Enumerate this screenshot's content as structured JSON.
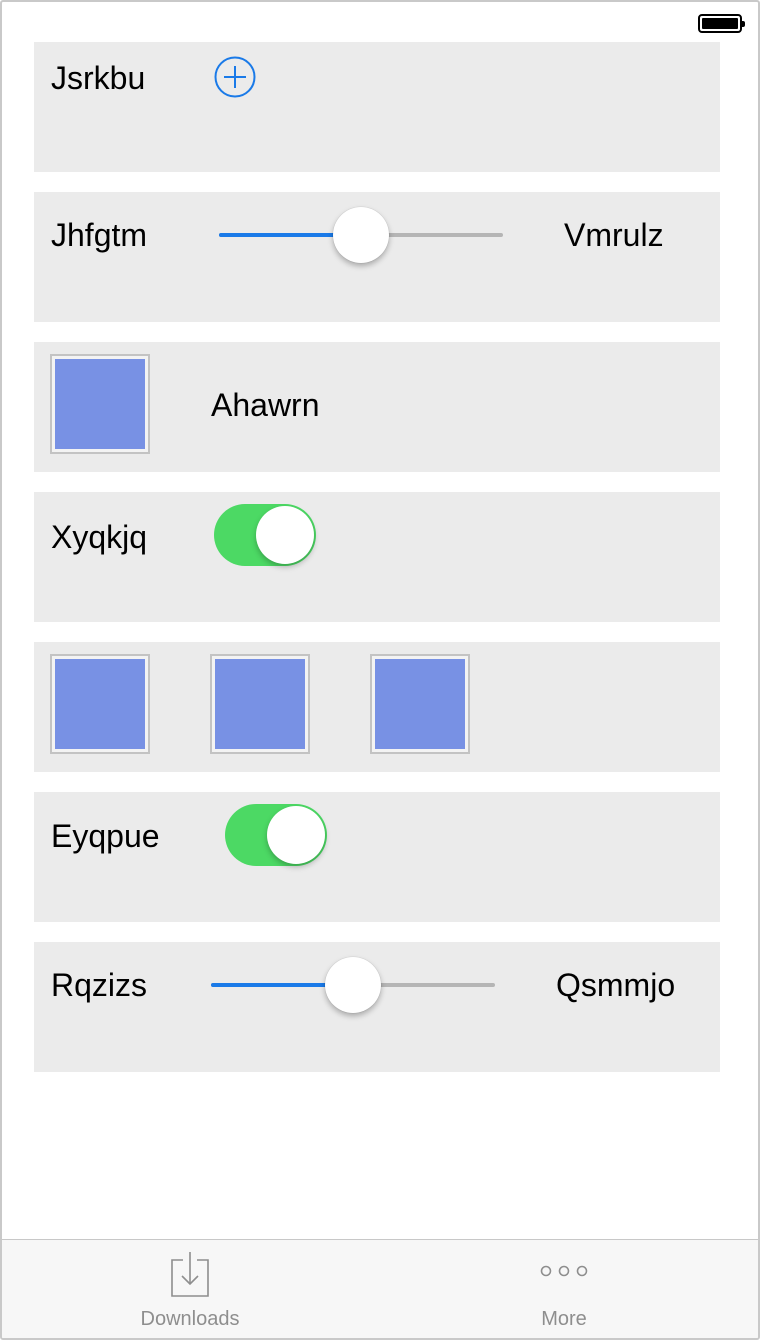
{
  "status_bar": {
    "battery_icon": "battery-full-icon"
  },
  "rows": {
    "row1": {
      "label": "Jsrkbu",
      "icon": "plus-circle-icon",
      "accent": "#1a7ae8"
    },
    "row2": {
      "left_label": "Jhfgtm",
      "right_label": "Vmrulz",
      "slider_value": 0.5
    },
    "row3": {
      "label": "Ahawrn",
      "image_color": "#7891e4"
    },
    "row4": {
      "label": "Xyqkjq",
      "toggle_on": true,
      "toggle_color": "#4cd964"
    },
    "row5": {
      "image_count": 3,
      "image_color": "#7891e4"
    },
    "row6": {
      "label": "Eyqpue",
      "toggle_on": true
    },
    "row7": {
      "left_label": "Rqzizs",
      "right_label": "Qsmmjo",
      "slider_value": 0.5
    }
  },
  "tabbar": {
    "tabs": [
      {
        "label": "Downloads",
        "icon": "download-tray-icon"
      },
      {
        "label": "More",
        "icon": "more-dots-icon"
      }
    ]
  }
}
